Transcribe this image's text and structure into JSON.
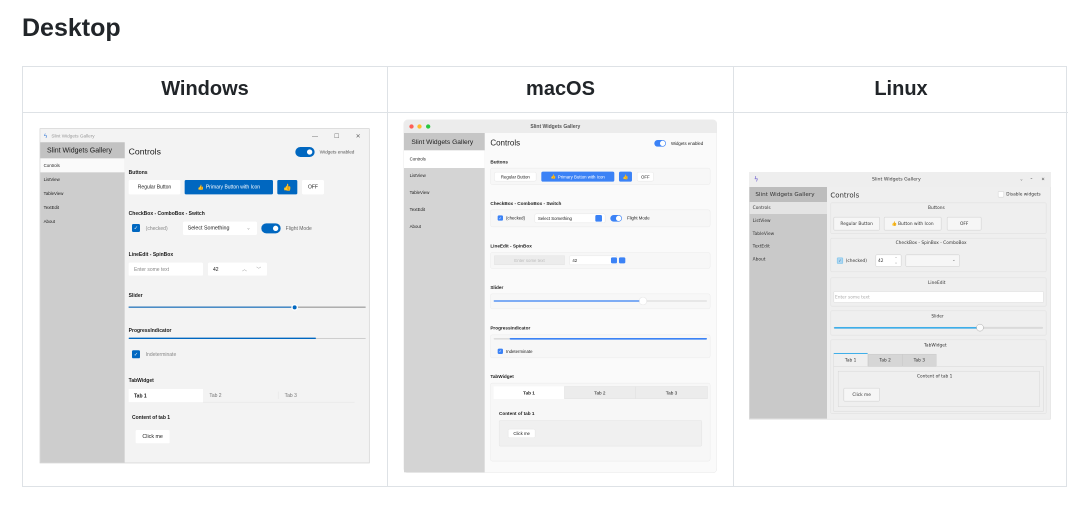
{
  "page": {
    "heading": "Desktop"
  },
  "table": {
    "columns": [
      "Windows",
      "macOS",
      "Linux"
    ]
  },
  "windows": {
    "title": "Slint Widgets Gallery",
    "sidebar_title": "Slint Widgets Gallery",
    "nav": [
      "Controls",
      "ListView",
      "TableView",
      "TextEdit",
      "About"
    ],
    "controls_title": "Controls",
    "widgets_enabled": "Widgets enabled",
    "buttons_heading": "Buttons",
    "regular": "Regular Button",
    "primary": "Primary Button with Icon",
    "off": "OFF",
    "checkbox_heading": "CheckBox - ComboBox - Switch",
    "checked": "(checked)",
    "combo": "Select Something",
    "flight_mode": "Flight Mode",
    "lineedit_heading": "LineEdit - SpinBox",
    "placeholder": "Enter some text",
    "spin_value": "42",
    "slider_heading": "Slider",
    "slider_value": 0.7,
    "progress_heading": "ProgressIndicator",
    "progress_value": 0.79,
    "indeterminate": "Indeterminate",
    "tab_heading": "TabWidget",
    "tabs": [
      "Tab 1",
      "Tab 2",
      "Tab 3"
    ],
    "tab_content": "Content of tab 1",
    "click_me": "Click me",
    "accent": "#0067c0"
  },
  "macos": {
    "title": "Slint Widgets Gallery",
    "sidebar_title": "Slint Widgets Gallery",
    "nav": [
      "Controls",
      "ListView",
      "TableView",
      "TextEdit",
      "About"
    ],
    "controls_title": "Controls",
    "widgets_enabled": "Widgets enabled",
    "buttons_heading": "Buttons",
    "regular": "Regular Button",
    "primary": "Primary Button with Icon",
    "off": "OFF",
    "checkbox_heading": "CheckBox - ComboBox - Switch",
    "checked": "(checked)",
    "combo": "Select Something",
    "flight_mode": "Flight Mode",
    "lineedit_heading": "LineEdit - SpinBox",
    "placeholder": "Enter some text",
    "spin_value": "42",
    "slider_heading": "Slider",
    "slider_value": 0.7,
    "progress_heading": "ProgressIndicator",
    "indeterminate": "Indeterminate",
    "tab_heading": "TabWidget",
    "tabs": [
      "Tab 1",
      "Tab 2",
      "Tab 3"
    ],
    "tab_content": "Content of tab 1",
    "click_me": "Click me",
    "accent": "#3b82f6"
  },
  "linux": {
    "title": "Slint Widgets Gallery",
    "sidebar_title": "Slint Widgets Gallery",
    "nav": [
      "Controls",
      "ListView",
      "TableView",
      "TextEdit",
      "About"
    ],
    "controls_title": "Controls",
    "disable_widgets": "Disable widgets",
    "buttons_heading": "Buttons",
    "regular": "Regular Button",
    "icon_button": "Button with Icon",
    "off": "OFF",
    "checkbox_heading": "CheckBox - SpinBox - ComboBox",
    "checked": "(checked)",
    "spin_value": "42",
    "lineedit_heading": "LineEdit",
    "placeholder": "Enter some text",
    "slider_heading": "Slider",
    "slider_value": 0.7,
    "tab_heading": "TabWidget",
    "tabs": [
      "Tab 1",
      "Tab 2",
      "Tab 3"
    ],
    "tab_content": "Content of tab 1",
    "click_me": "Click me",
    "accent": "#3daee9"
  }
}
